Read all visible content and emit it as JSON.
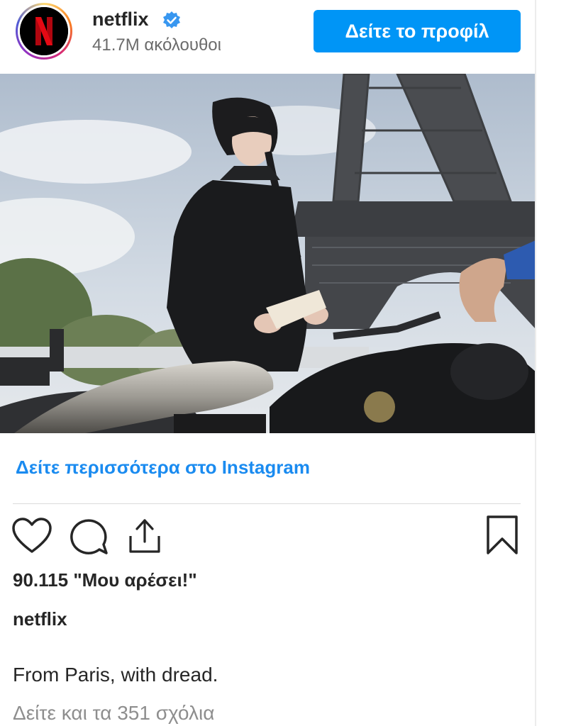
{
  "header": {
    "username": "netflix",
    "followers": "41.7M ακόλουθοι",
    "view_profile_label": "Δείτε το προφίλ",
    "avatar_icon": "netflix-logo-icon",
    "verified_icon": "verified-badge-icon"
  },
  "post": {
    "image_subject": "photo"
  },
  "links": {
    "see_more": "Δείτε περισσότερα στο Instagram"
  },
  "actions": {
    "like_icon": "heart-icon",
    "comment_icon": "comment-icon",
    "share_icon": "share-icon",
    "save_icon": "bookmark-icon"
  },
  "engagement": {
    "likes_text": "90.115 \"Μου αρέσει!\""
  },
  "caption": {
    "username": "netflix",
    "text": "From Paris, with dread."
  },
  "comments": {
    "view_all": "Δείτε και τα 351 σχόλια"
  },
  "colors": {
    "accent": "#0095f6",
    "link": "#1a8bf0",
    "text": "#262626",
    "muted": "#8e8e8e",
    "netflix_red": "#e50914"
  }
}
